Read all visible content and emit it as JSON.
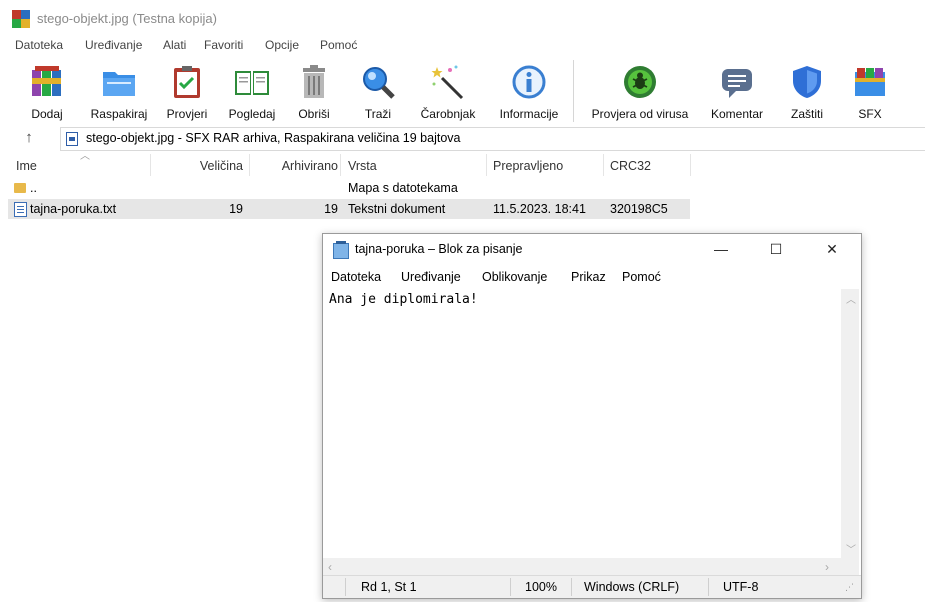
{
  "window": {
    "title": "stego-objekt.jpg (Testna kopija)"
  },
  "menu": [
    "Datoteka",
    "Uređivanje",
    "Alati",
    "Favoriti",
    "Opcije",
    "Pomoć"
  ],
  "toolbar": {
    "buttons": [
      {
        "label": "Dodaj",
        "icon": "add-archive-icon"
      },
      {
        "label": "Raspakiraj",
        "icon": "extract-folder-icon"
      },
      {
        "label": "Provjeri",
        "icon": "test-clipboard-icon"
      },
      {
        "label": "Pogledaj",
        "icon": "view-book-icon"
      },
      {
        "label": "Obriši",
        "icon": "trash-icon"
      },
      {
        "label": "Traži",
        "icon": "magnifier-icon"
      },
      {
        "label": "Čarobnjak",
        "icon": "wizard-wand-icon"
      },
      {
        "label": "Informacije",
        "icon": "info-icon"
      },
      {
        "label": "Provjera od virusa",
        "icon": "virus-scan-icon"
      },
      {
        "label": "Komentar",
        "icon": "comment-icon"
      },
      {
        "label": "Zaštiti",
        "icon": "shield-icon"
      },
      {
        "label": "SFX",
        "icon": "sfx-icon"
      }
    ]
  },
  "address": {
    "path": "stego-objekt.jpg - SFX RAR arhiva, Raspakirana veličina 19 bajtova"
  },
  "columns": [
    "Ime",
    "Veličina",
    "Arhivirano",
    "Vrsta",
    "Prepravljeno",
    "CRC32"
  ],
  "rows": [
    {
      "name": "..",
      "size": "",
      "packed": "",
      "type": "Mapa s datotekama",
      "modified": "",
      "crc": ""
    },
    {
      "name": "tajna-poruka.txt",
      "size": "19",
      "packed": "19",
      "type": "Tekstni dokument",
      "modified": "11.5.2023. 18:41",
      "crc": "320198C5"
    }
  ],
  "notepad": {
    "title": "tajna-poruka – Blok za pisanje",
    "menu": [
      "Datoteka",
      "Uređivanje",
      "Oblikovanje",
      "Prikaz",
      "Pomoć"
    ],
    "content": "Ana je diplomirala!",
    "window_buttons": {
      "minimize": "—",
      "maximize": "☐",
      "close": "✕"
    },
    "status": {
      "position": "Rd 1, St 1",
      "zoom": "100%",
      "line_ending": "Windows (CRLF)",
      "encoding": "UTF-8"
    }
  },
  "colors": {
    "selected_row": "#e6e6e6",
    "title_text": "#8a8a8a",
    "accent_blue": "#2f5ea8"
  }
}
